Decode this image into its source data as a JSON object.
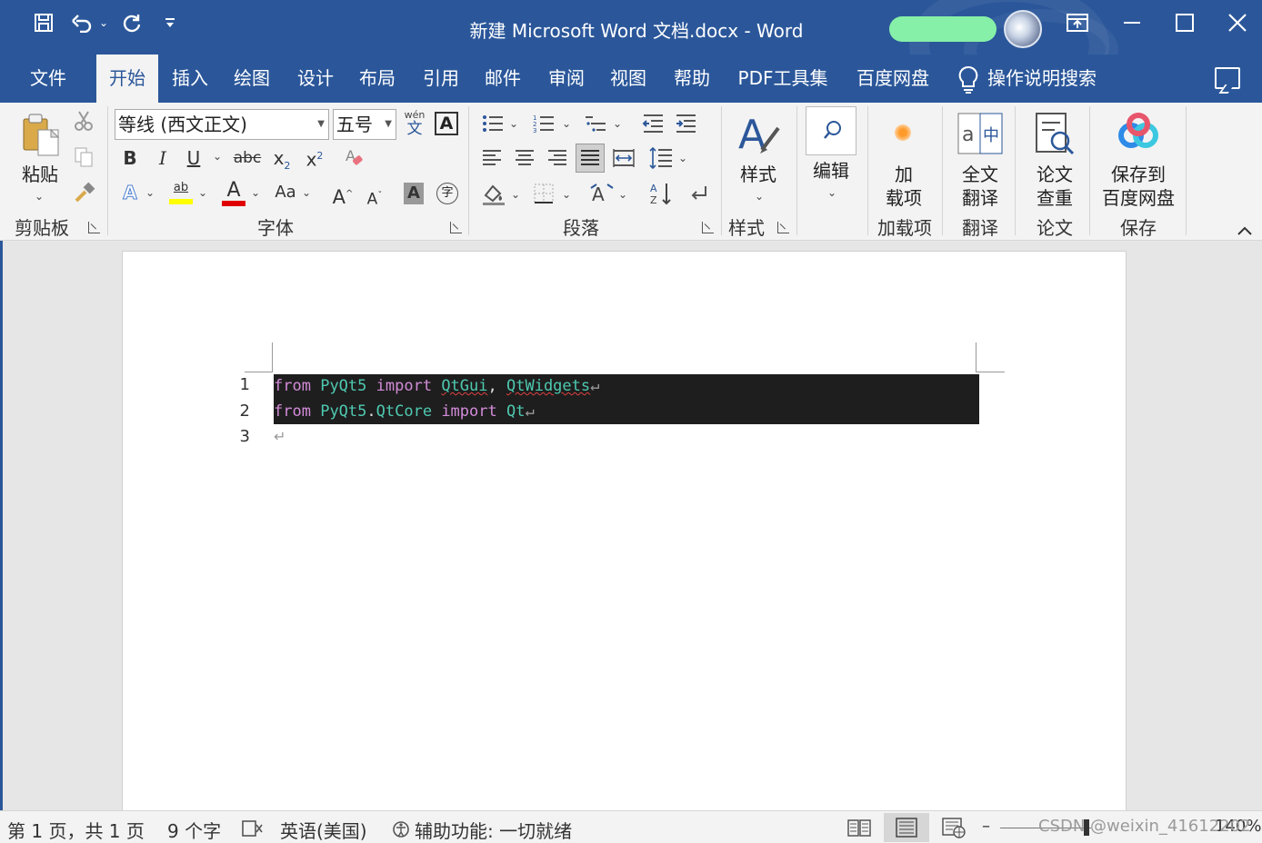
{
  "window": {
    "title": "新建 Microsoft Word 文档.docx  -  Word"
  },
  "qat": {
    "save_icon": "save-icon",
    "undo_icon": "undo-icon",
    "redo_icon": "redo-icon",
    "customize_icon": "customize-qat-icon"
  },
  "tabs": [
    {
      "label": "文件"
    },
    {
      "label": "开始"
    },
    {
      "label": "插入"
    },
    {
      "label": "绘图"
    },
    {
      "label": "设计"
    },
    {
      "label": "布局"
    },
    {
      "label": "引用"
    },
    {
      "label": "邮件"
    },
    {
      "label": "审阅"
    },
    {
      "label": "视图"
    },
    {
      "label": "帮助"
    },
    {
      "label": "PDF工具集"
    },
    {
      "label": "百度网盘"
    }
  ],
  "tell_me": "操作说明搜索",
  "ribbon": {
    "clipboard": {
      "paste": "粘贴",
      "group": "剪贴板"
    },
    "font": {
      "name": "等线 (西文正文)",
      "size": "五号",
      "wen": "wén",
      "wen_char": "文",
      "group": "字体",
      "bold": "B",
      "italic": "I",
      "underline": "U",
      "strike": "abc",
      "sub": "x",
      "sub_mark": "2",
      "sup": "x",
      "sup_mark": "2",
      "grow": "A",
      "shrink": "A",
      "change_case": "Aa",
      "char_border": "A",
      "char_shade": "A",
      "enclose": "字",
      "effect": "A",
      "font_color": "A",
      "highlight": "ab"
    },
    "paragraph": {
      "group": "段落"
    },
    "styles": {
      "label": "样式",
      "group": "样式"
    },
    "editing": {
      "label": "编辑"
    },
    "addins": {
      "line1": "加",
      "line2": "载项",
      "group": "加载项"
    },
    "translate": {
      "line1": "全文",
      "line2": "翻译",
      "group": "翻译"
    },
    "thesis": {
      "line1": "论文",
      "line2": "查重",
      "group": "论文"
    },
    "baidu": {
      "line1": "保存到",
      "line2": "百度网盘",
      "group": "保存"
    }
  },
  "document": {
    "line_numbers": [
      "1",
      "2",
      "3"
    ],
    "code": [
      {
        "kw1": "from",
        "mod": "PyQt5",
        "kw2": "import",
        "c1": "QtGui",
        "comma": ",",
        "c2": "QtWidgets"
      },
      {
        "kw1": "from",
        "mod": "PyQt5",
        "dot": ".",
        "sub": "QtCore",
        "kw2": "import",
        "c1": "Qt"
      }
    ],
    "para_mark": "↵"
  },
  "status": {
    "page": "第 1 页，共 1 页",
    "words": "9 个字",
    "language": "英语(美国)",
    "accessibility": "辅助功能: 一切就绪",
    "zoom": "140%",
    "watermark": "CSDN @weixin_41612202"
  },
  "colors": {
    "accent": "#2b579a",
    "code_bg": "#1e1e1e",
    "keyword": "#d38bd8",
    "identifier": "#4ec9b0"
  }
}
